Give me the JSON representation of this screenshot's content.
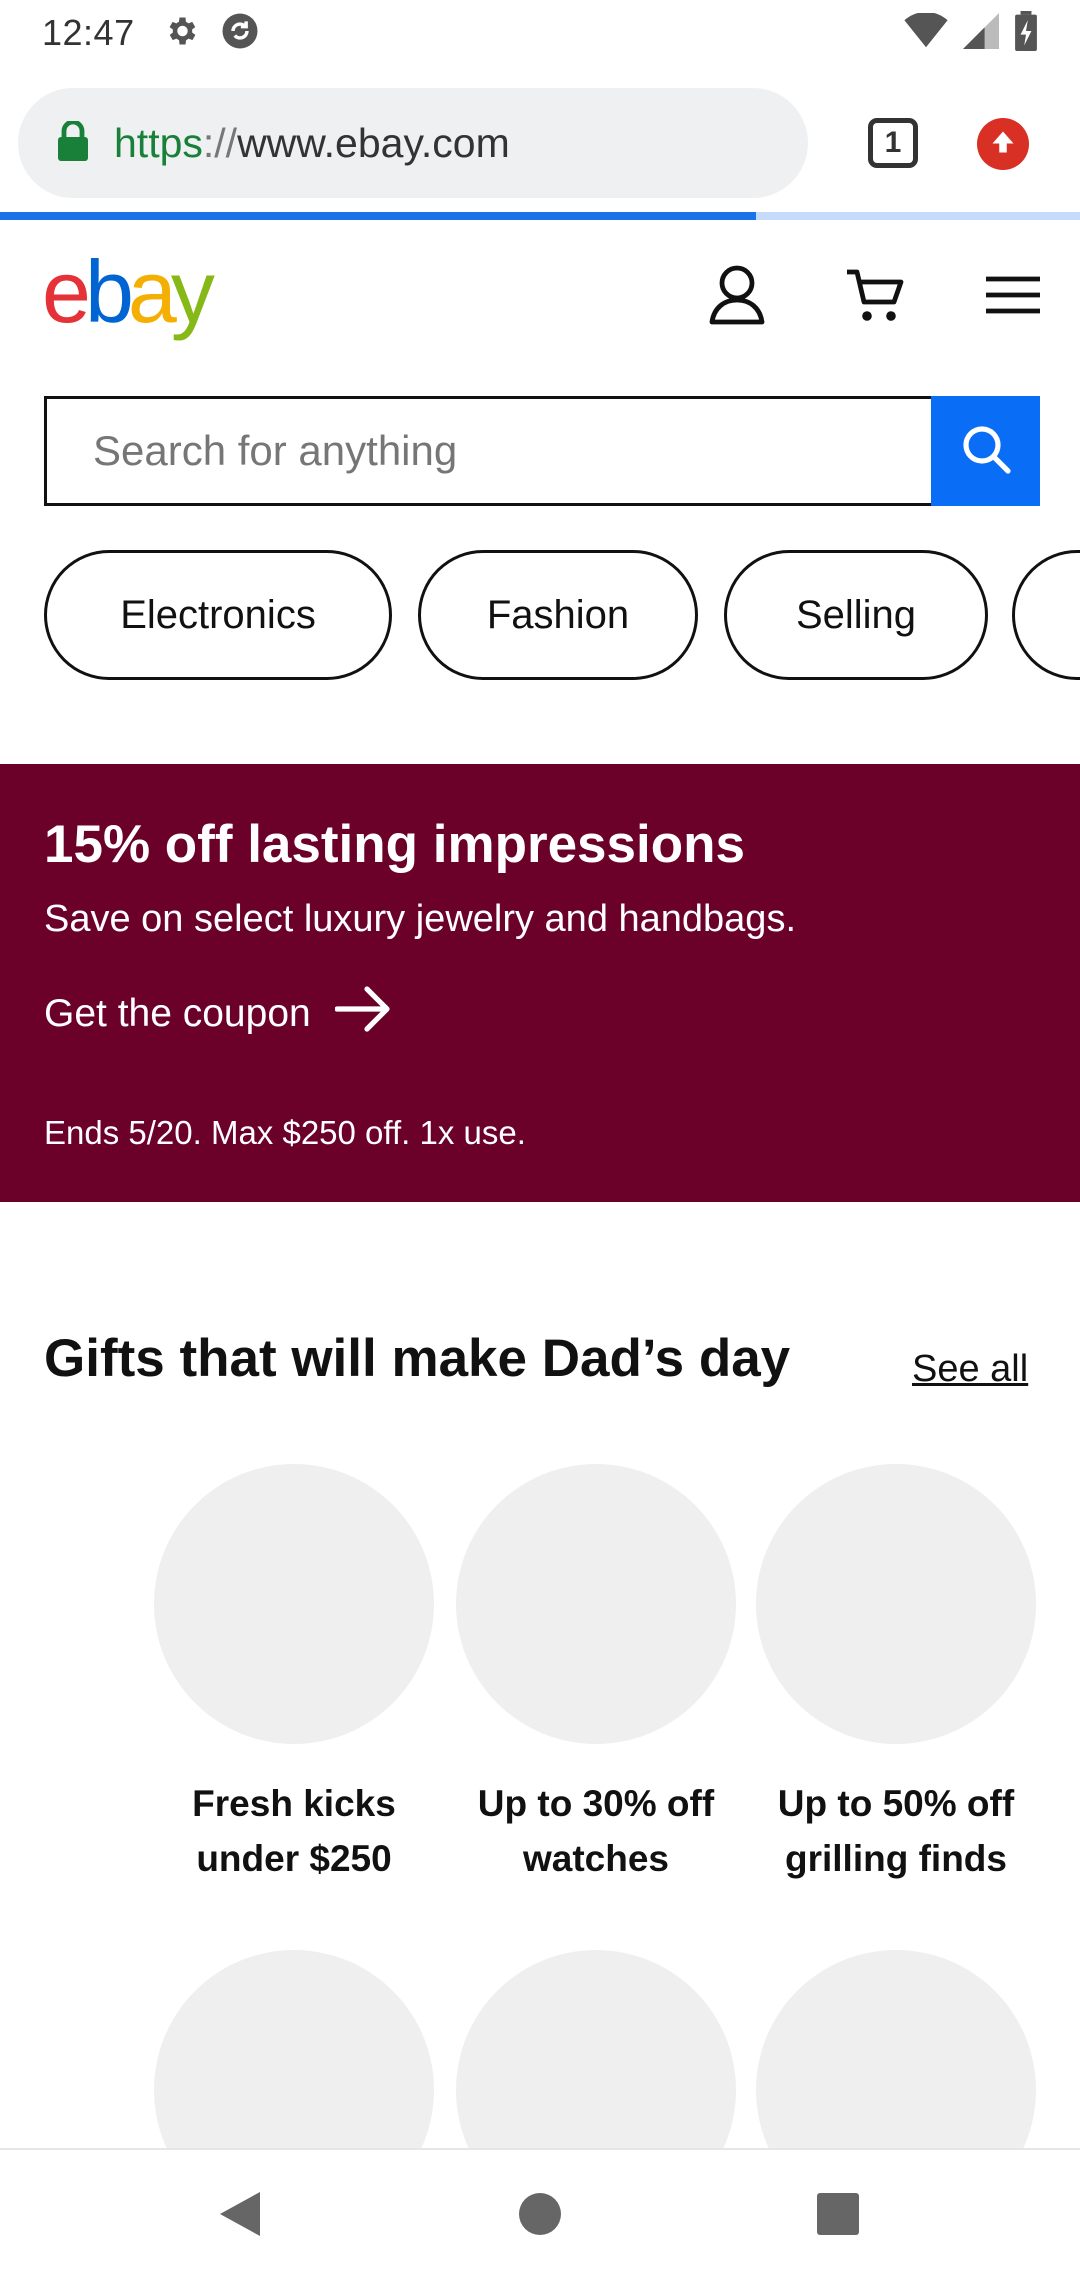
{
  "status_bar": {
    "time": "12:47",
    "left_icons": [
      "settings-icon",
      "sync-icon"
    ],
    "right_icons": [
      "wifi-icon",
      "cell-signal-icon",
      "battery-icon"
    ]
  },
  "browser": {
    "url_scheme": "https",
    "url_sep": "://",
    "url_host": "www.ebay.com",
    "tab_count": "1",
    "progress": 0.7
  },
  "header": {
    "logo": {
      "e": "e",
      "b": "b",
      "a": "a",
      "y": "y"
    },
    "icons": [
      "account-icon",
      "cart-icon",
      "menu-icon"
    ]
  },
  "search": {
    "placeholder": "Search for anything",
    "value": ""
  },
  "categories": [
    "Electronics",
    "Fashion",
    "Selling",
    ""
  ],
  "promo": {
    "title": "15% off lasting impressions",
    "subtitle": "Save on select luxury jewelry and handbags.",
    "cta": "Get the coupon",
    "terms": "Ends 5/20. Max $250 off. 1x use.",
    "background": "#6b0029"
  },
  "gifts": {
    "title": "Gifts that will make Dad’s day",
    "see_all": "See all",
    "items": [
      {
        "line1": "Fresh kicks",
        "line2": "under $250"
      },
      {
        "line1": "Up to 30% off",
        "line2": "watches"
      },
      {
        "line1": "Up to 50% off",
        "line2": "grilling finds"
      }
    ]
  },
  "colors": {
    "accent_blue": "#0a6df5",
    "promo_bg": "#6b0029",
    "placeholder_gray": "#efefef"
  }
}
